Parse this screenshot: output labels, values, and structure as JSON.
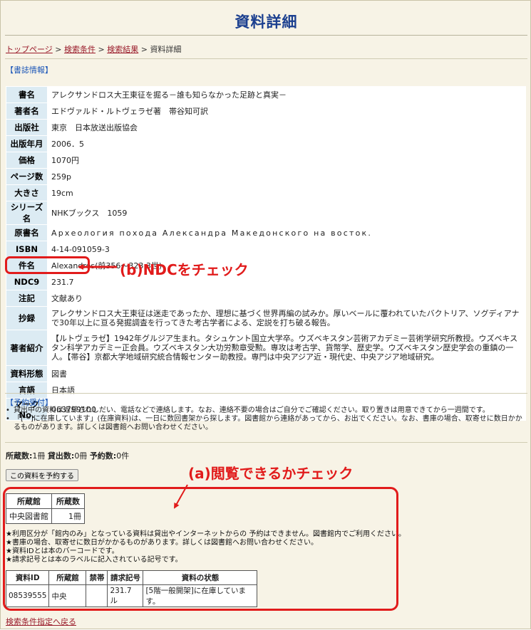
{
  "page": {
    "title": "資料詳細"
  },
  "breadcrumb": {
    "top": "トップページ",
    "conditions": "検索条件",
    "results": "検索結果",
    "current": "資料詳細",
    "sep": " > "
  },
  "biblio": {
    "section_label": "【書誌情報】",
    "rows": [
      {
        "label": "書名",
        "value": "アレクサンドロス大王東征を掘る－誰も知らなかった足跡と真実－"
      },
      {
        "label": "著者名",
        "value": "エドヴァルド・ルトヴェラゼ著　帯谷知可訳"
      },
      {
        "label": "出版社",
        "value": "東京　日本放送出版協会"
      },
      {
        "label": "出版年月",
        "value": "2006．5"
      },
      {
        "label": "価格",
        "value": "1070円"
      },
      {
        "label": "ページ数",
        "value": "259p"
      },
      {
        "label": "大きさ",
        "value": "19cm"
      },
      {
        "label": "シリーズ名",
        "value": "NHKブックス　1059"
      },
      {
        "label": "原書名",
        "value": "Археология похода Александра Македонского на восток."
      },
      {
        "label": "ISBN",
        "value": "4-14-091059-3"
      },
      {
        "label": "件名",
        "value": "Alexandros(前356～323  3世)"
      },
      {
        "label": "NDC9",
        "value": "231.7"
      },
      {
        "label": "注記",
        "value": "文献あり"
      },
      {
        "label": "抄録",
        "value": "アレクサンドロス大王東征は迷走であったか、理想に基づく世界再編の試みか。厚いベールに覆われていたバクトリア、ソグディアナで30年以上に亘る発掘調査を行ってきた考古学者による、定説を打ち破る報告。"
      },
      {
        "label": "著者紹介",
        "value": "【ルトヴェラゼ】1942年グルジア生まれ。タシュケント国立大学卒。ウズベキスタン芸術アカデミー芸術学研究所教授。ウズベキスタン科学アカデミー正会員。ウズベキスタン大功労勲章受勲。専攻は考古学、貨幣学、歴史学。ウズベキスタン歴史学会の重鎮の一人。【帯谷】京都大学地域研究統合情報センター助教授。専門は中央アジア近・現代史、中央アジア地域研究。"
      },
      {
        "label": "資料形態",
        "value": "図書"
      },
      {
        "label": "言語",
        "value": "日本語"
      },
      {
        "label": "マークNo.",
        "value": "063799100"
      }
    ]
  },
  "reservation": {
    "section_label": "【予約受付】",
    "notes": [
      "貸出中の資料は返却されしだい、電話などで連絡します。なお、連絡不要の場合はご自分でご確認ください。取り置きは用意できてから一週間です。",
      "「[～]に在庫しています」(在庫資料)は、一日に数回書架から探します。図書館から連絡があってから、お出でください。なお、書庫の場合、取寄せに数日かかるものがあります。詳しくは図書館へお問い合わせください。"
    ]
  },
  "counts": {
    "holdings_label": "所蔵数:",
    "holdings_value": "1冊",
    "loans_label": "貸出数:",
    "loans_value": "0冊",
    "reserves_label": "予約数:",
    "reserves_value": "0件"
  },
  "reserve_button": "この資料を予約する",
  "holdings_table": {
    "headers": [
      "所蔵館",
      "所蔵数"
    ],
    "rows": [
      [
        "中央図書館",
        "1冊"
      ]
    ]
  },
  "rules": [
    "★利用区分が「館内のみ」となっている資料は貸出やインターネットからの 予約はできません。図書館内でご利用ください。",
    "★書庫の場合、取寄せに数日がかかるものがあります。詳しくは図書館へお問い合わせください。",
    "★資料IDとは本のバーコードです。",
    "★請求記号とは本のラベルに記入されている記号です。"
  ],
  "items_table": {
    "headers": [
      "資料ID",
      "所蔵館",
      "禁帯",
      "請求記号",
      "資料の状態"
    ],
    "rows": [
      [
        "08539555",
        "中央",
        "",
        "231.7 ル",
        "[5階一般開架]に在庫しています。"
      ]
    ]
  },
  "back_link": "検索条件指定へ戻る",
  "annotations": {
    "a": "(a)閲覧できるかチェック",
    "b": "(b)NDCをチェック",
    "color": "#e11b1b"
  }
}
